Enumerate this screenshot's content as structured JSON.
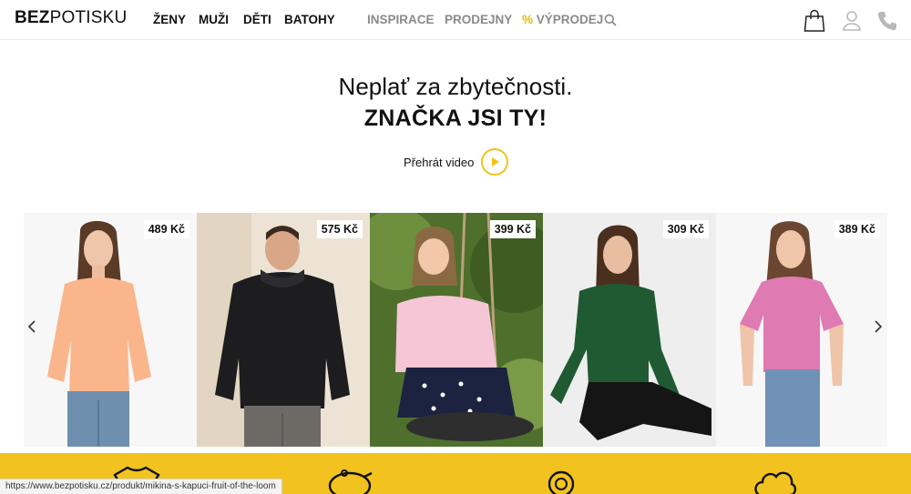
{
  "header": {
    "logo_bold": "BEZ",
    "logo_light": "POTISKU",
    "main_nav": [
      "ŽENY",
      "MUŽI",
      "DĚTI",
      "BATOHY"
    ],
    "secondary_nav": [
      "INSPIRACE",
      "PRODEJNY"
    ],
    "sale_symbol": "%",
    "sale_label": "VÝPRODEJ",
    "icons": [
      "search-icon",
      "shopping-bag-icon",
      "user-icon",
      "phone-icon"
    ]
  },
  "hero": {
    "line1": "Neplať za zbytečnosti.",
    "line2": "ZNAČKA JSI TY!",
    "play_label": "Přehrát video"
  },
  "carousel": {
    "products": [
      {
        "price": "489 Kč",
        "garment": "peach sweatshirt"
      },
      {
        "price": "575 Kč",
        "garment": "black hoodie"
      },
      {
        "price": "399 Kč",
        "garment": "pink kids hoodie"
      },
      {
        "price": "309 Kč",
        "garment": "green long sleeve tee"
      },
      {
        "price": "389 Kč",
        "garment": "pink t-shirt"
      }
    ],
    "prev_icon": "chevron-left-icon",
    "next_icon": "chevron-right-icon"
  },
  "features": {
    "icons": [
      "tshirt-icon",
      "piggy-bank-icon",
      "badge-icon",
      "cloud-icon"
    ]
  },
  "status_bar": {
    "url": "https://www.bezpotisku.cz/produkt/mikina-s-kapuci-fruit-of-the-loom"
  },
  "colors": {
    "accent": "#f2c31f",
    "sale": "#e8b70a",
    "muted_nav": "#8a8a8a"
  }
}
